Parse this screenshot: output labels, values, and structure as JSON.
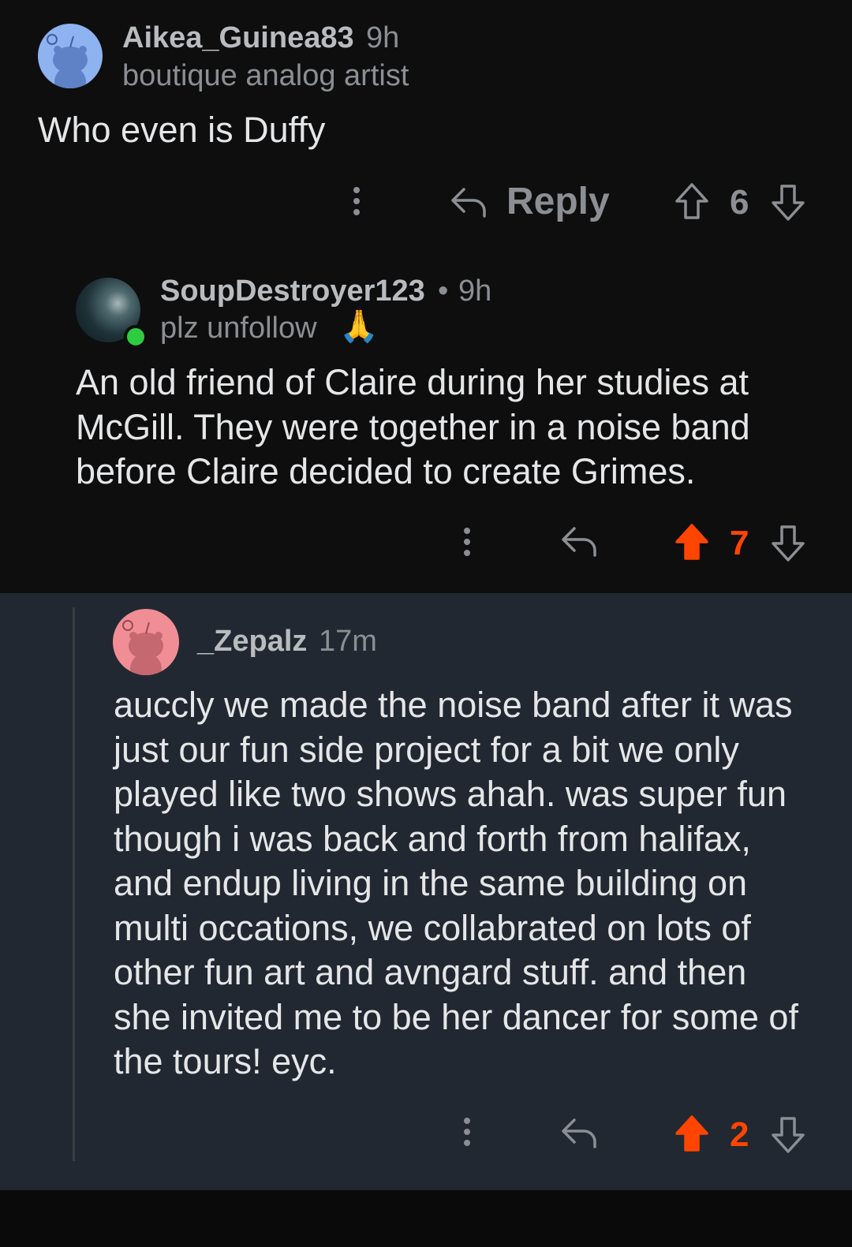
{
  "comments": [
    {
      "username": "Aikea_Guinea83",
      "time": "9h",
      "flair": "boutique analog artist",
      "body": "Who even is Duffy",
      "reply_label": "Reply",
      "votes": "6",
      "upvoted": false,
      "avatar_color": "#8fb2f0"
    },
    {
      "username": "SoupDestroyer123",
      "separator": "•",
      "time": "9h",
      "flair": "plz unfollow",
      "flair_emoji": "🙏",
      "body": "An old friend of Claire during her studies at McGill. They were together in a noise band before Claire decided to create Grimes.",
      "votes": "7",
      "upvoted": true,
      "online": true
    },
    {
      "username": "_Zepalz",
      "time": "17m",
      "body": "auccly we made the noise band after it was just our fun side project for a bit we only played like two shows ahah. was super fun though i was back and forth from halifax, and endup living in the same building on multi occations, we collabrated on lots of other fun art and avngard stuff. and then she invited me to be her dancer for some of the tours! eyc.",
      "votes": "2",
      "upvoted": true,
      "avatar_color": "#f08d95"
    }
  ],
  "colors": {
    "upvote_orange": "#ff4500",
    "muted_gray": "#8b8f93",
    "highlight_bg": "#222831",
    "online_green": "#2ecc40"
  }
}
